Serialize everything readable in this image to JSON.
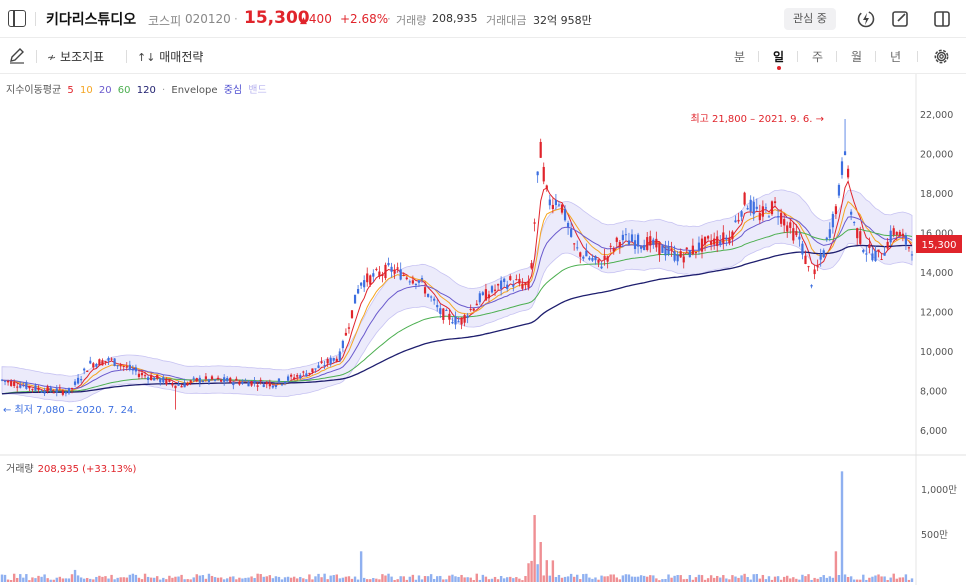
{
  "header": {
    "stock_name": "키다리스튜디오",
    "market": "코스피",
    "code": "020120",
    "separator": "·",
    "price": "15,300",
    "change_arrow": "▲",
    "change": "400",
    "rate": "+2.68%",
    "volume_label": "거래량",
    "volume": "208,935",
    "amount_label": "거래대금",
    "amount": "32억 958만",
    "favorite_label": "관심 중"
  },
  "toolbar": {
    "indicator_label": "보조지표",
    "strategy_label": "매매전략",
    "periods": [
      "분",
      "일",
      "주",
      "월",
      "년"
    ],
    "active_period": "일"
  },
  "legend": {
    "ma_label": "지수이동평균",
    "ma_periods": [
      "5",
      "10",
      "20",
      "60",
      "120"
    ],
    "separator": "·",
    "envelope_label": "Envelope",
    "envelope_center": "중심",
    "envelope_band": "밴드"
  },
  "colors": {
    "up": "#e0242b",
    "down": "#3d6fe0",
    "ma5": "#e0242b",
    "ma10": "#f5a623",
    "ma20": "#6a5acd",
    "ma60": "#4caf50",
    "ma120": "#1e1e6e",
    "envelope_fill": "#ecebfb"
  },
  "chart_data": {
    "type": "candlestick",
    "y_ticks": [
      "22,000",
      "20,000",
      "18,000",
      "16,000",
      "14,000",
      "12,000",
      "10,000",
      "8,000",
      "6,000"
    ],
    "current_price_label": "15,300",
    "high_annotation": "최고 21,800 – 2021. 9. 6. →",
    "low_annotation": "← 최저 7,080 – 2020. 7. 24.",
    "volume_label": "거래량",
    "volume_value": "208,935 (+33.13%)",
    "volume_ticks": [
      "1,000만",
      "500만"
    ]
  }
}
